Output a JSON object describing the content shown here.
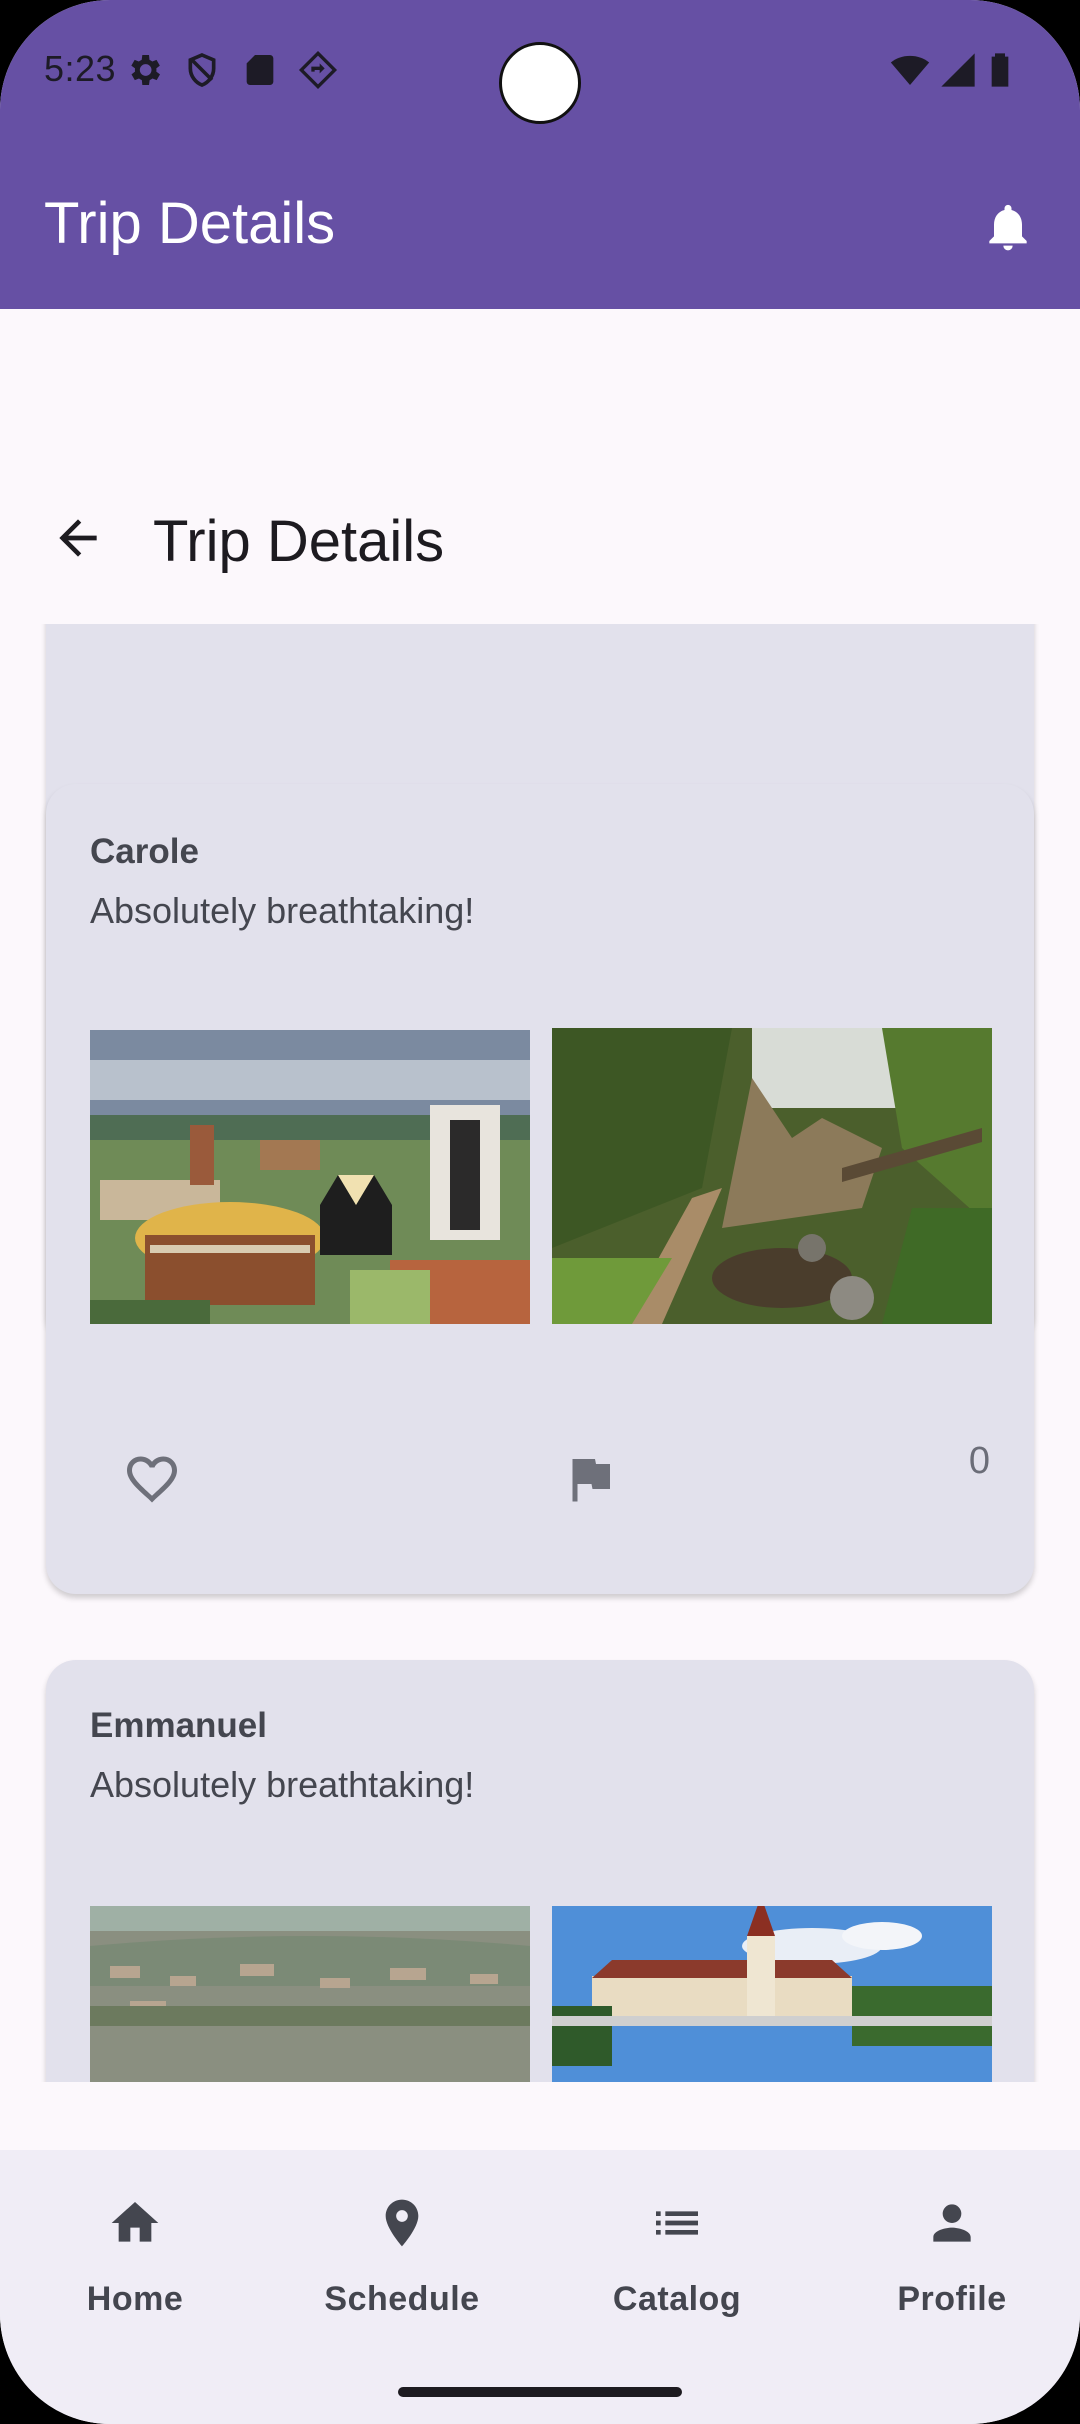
{
  "status_bar": {
    "time": "5:23",
    "icons": [
      "gear-icon",
      "shield-icon",
      "sd-card-icon",
      "navigation-icon",
      "wifi-icon",
      "signal-icon",
      "battery-icon"
    ]
  },
  "app_bar": {
    "title": "Trip Details",
    "action_icon": "bell-icon"
  },
  "page_header": {
    "title": "Trip Details",
    "back_icon": "arrow-back-icon"
  },
  "comments": [
    {
      "author": "",
      "text": "",
      "photos": [],
      "like_icon": "heart-outline-icon",
      "flag_icon": "flag-icon",
      "count": ""
    },
    {
      "author": "Carole",
      "text": "Absolutely breathtaking!",
      "photos": [
        "city-skyline-photo",
        "jungle-path-photo"
      ],
      "like_icon": "heart-outline-icon",
      "flag_icon": "flag-icon",
      "count": "0"
    },
    {
      "author": "Emmanuel",
      "text": "Absolutely breathtaking!",
      "photos": [
        "city-panorama-photo",
        "church-photo"
      ]
    }
  ],
  "bottom_nav": {
    "items": [
      {
        "label": "Home",
        "icon": "home-icon"
      },
      {
        "label": "Schedule",
        "icon": "location-pin-icon"
      },
      {
        "label": "Catalog",
        "icon": "list-icon"
      },
      {
        "label": "Profile",
        "icon": "person-icon"
      }
    ]
  },
  "colors": {
    "primary": "#6650a4",
    "card": "#e2e1ec",
    "surface": "#fcf8fc",
    "nav": "#f0edf6"
  }
}
